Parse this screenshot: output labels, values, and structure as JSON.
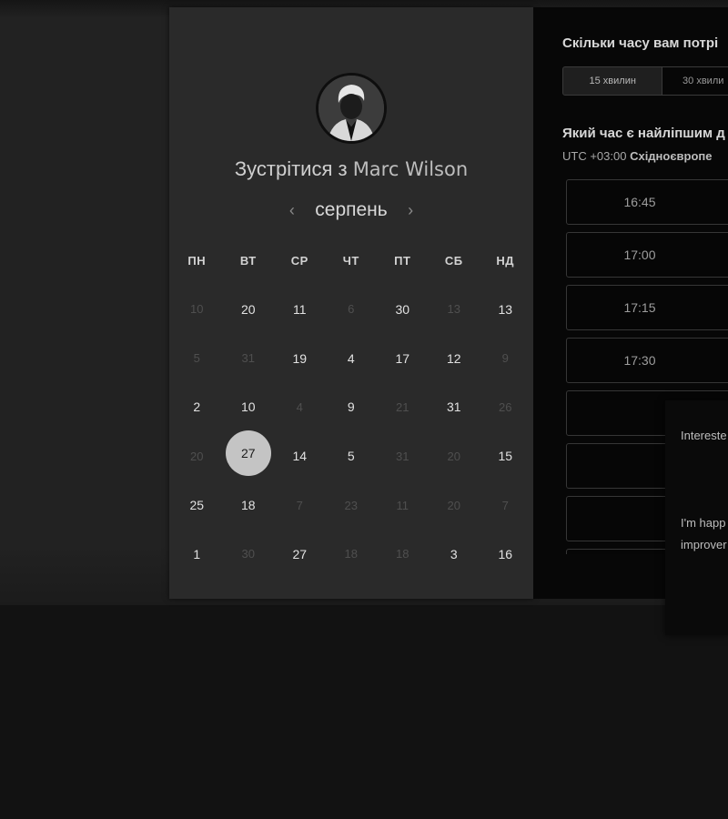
{
  "calendar": {
    "title_prefix": "Зустрітися з",
    "host_name": "Marc Wilson",
    "month": "серпень",
    "prev_icon": "‹",
    "next_icon": "›",
    "weekdays": [
      "ПН",
      "ВТ",
      "СР",
      "ЧТ",
      "ПТ",
      "СБ",
      "НД"
    ],
    "weeks": [
      [
        {
          "d": "10",
          "m": true
        },
        {
          "d": "20",
          "m": false
        },
        {
          "d": "11",
          "m": false
        },
        {
          "d": "6",
          "m": true
        },
        {
          "d": "30",
          "m": false
        },
        {
          "d": "13",
          "m": true
        },
        {
          "d": "13",
          "m": false
        }
      ],
      [
        {
          "d": "5",
          "m": true
        },
        {
          "d": "31",
          "m": true
        },
        {
          "d": "19",
          "m": false
        },
        {
          "d": "4",
          "m": false
        },
        {
          "d": "17",
          "m": false
        },
        {
          "d": "12",
          "m": false
        },
        {
          "d": "9",
          "m": true
        }
      ],
      [
        {
          "d": "2",
          "m": false
        },
        {
          "d": "10",
          "m": false
        },
        {
          "d": "4",
          "m": true
        },
        {
          "d": "9",
          "m": false
        },
        {
          "d": "21",
          "m": true
        },
        {
          "d": "31",
          "m": false
        },
        {
          "d": "26",
          "m": true
        }
      ],
      [
        {
          "d": "20",
          "m": true
        },
        {
          "d": "27",
          "m": false,
          "selected": true
        },
        {
          "d": "14",
          "m": false
        },
        {
          "d": "5",
          "m": false
        },
        {
          "d": "31",
          "m": true
        },
        {
          "d": "20",
          "m": true
        },
        {
          "d": "15",
          "m": false
        }
      ],
      [
        {
          "d": "25",
          "m": false
        },
        {
          "d": "18",
          "m": false
        },
        {
          "d": "7",
          "m": true
        },
        {
          "d": "23",
          "m": true
        },
        {
          "d": "11",
          "m": true
        },
        {
          "d": "20",
          "m": true
        },
        {
          "d": "7",
          "m": true
        }
      ],
      [
        {
          "d": "1",
          "m": false
        },
        {
          "d": "30",
          "m": true
        },
        {
          "d": "27",
          "m": false
        },
        {
          "d": "18",
          "m": true
        },
        {
          "d": "18",
          "m": true
        },
        {
          "d": "3",
          "m": false
        },
        {
          "d": "16",
          "m": false
        }
      ]
    ]
  },
  "scheduler": {
    "duration_question": "Скільки часу вам потрі",
    "durations": [
      "15 хвилин",
      "30 хвили"
    ],
    "best_time_question": "Який час є найліпшим д",
    "tz_offset": "UTC +03:00",
    "tz_name": "Східноєвропе",
    "slots": [
      "16:45",
      "17:00",
      "17:15",
      "17:30",
      "",
      "",
      "",
      ""
    ]
  },
  "chat": {
    "paragraph1": "Intereste Manage departm",
    "paragraph2": "I'm happ insight ir use our p improver productiv"
  }
}
